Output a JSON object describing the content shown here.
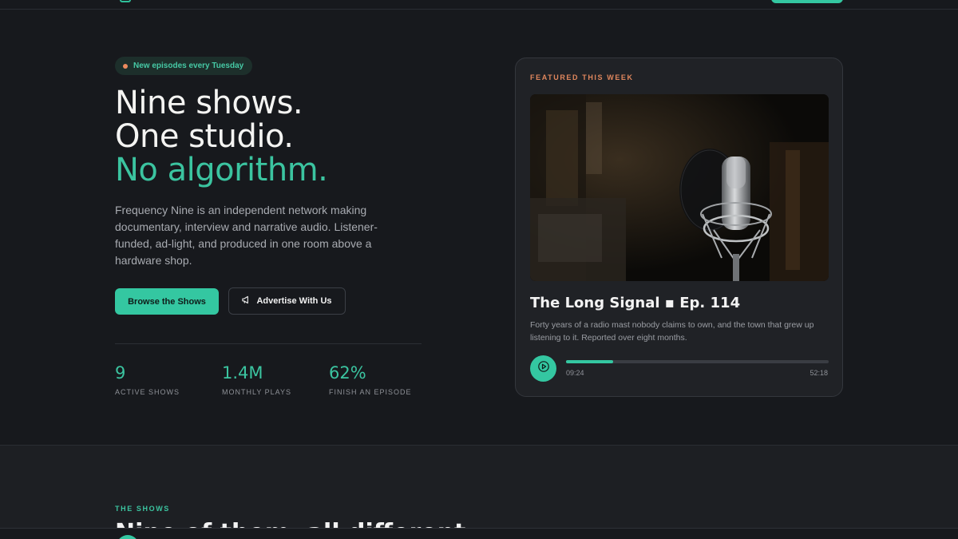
{
  "hero": {
    "badge": "New episodes every Tuesday",
    "headline_line1": "Nine shows.",
    "headline_line2": "One studio.",
    "headline_line3": "No algorithm.",
    "lede": "Frequency Nine is an independent network making documentary, interview and narrative audio. Listener-funded, ad-light, and produced in one room above a hardware shop.",
    "primary_button": "Browse the Shows",
    "secondary_button": "Advertise With Us",
    "stats": [
      {
        "value": "9",
        "label": "ACTIVE SHOWS"
      },
      {
        "value": "1.4M",
        "label": "MONTHLY PLAYS"
      },
      {
        "value": "62%",
        "label": "FINISH AN EPISODE"
      }
    ]
  },
  "featured": {
    "eyebrow": "FEATURED THIS WEEK",
    "title": "The Long Signal ▪ Ep. 114",
    "description": "Forty years of a radio mast nobody claims to own, and the town that grew up listening to it. Reported over eight months.",
    "current_time": "09:24",
    "total_time": "52:18",
    "progress": 0.18
  },
  "shows": {
    "eyebrow": "THE SHOWS",
    "heading": "Nine of them, all different"
  },
  "colors": {
    "accent": "#34c7a1",
    "warm": "#e0875d",
    "background": "#17191d"
  },
  "icons": {
    "secondary_button": "megaphone-icon",
    "play": "play-icon"
  }
}
